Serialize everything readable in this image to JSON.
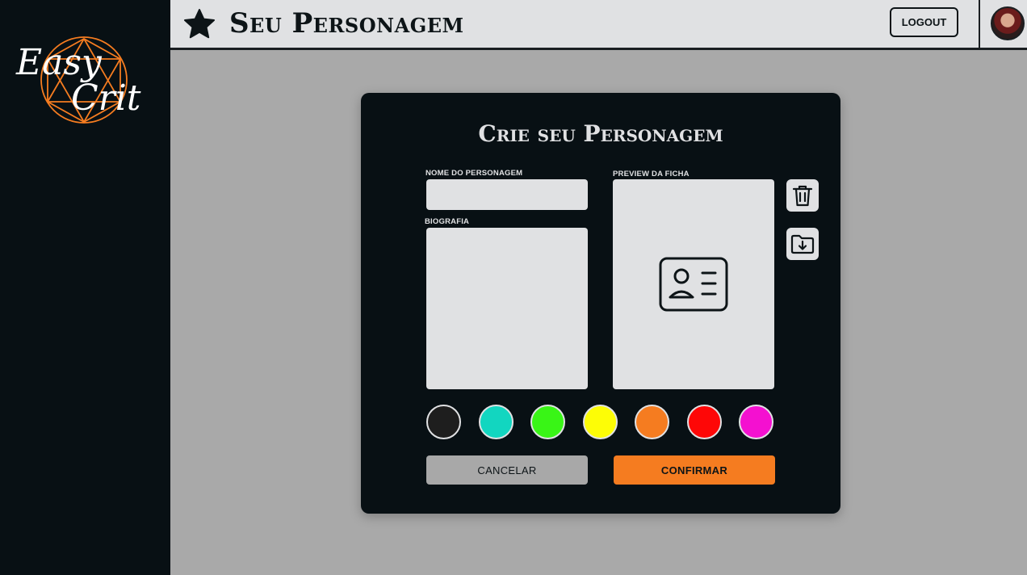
{
  "brand": {
    "line1": "Easy",
    "line2": "Crit"
  },
  "header": {
    "title": "Seu Personagem",
    "logout_label": "LOGOUT"
  },
  "modal": {
    "title": "Crie seu Personagem",
    "name_label": "NOME DO PERSONAGEM",
    "name_value": "",
    "bio_label": "BIOGRAFIA",
    "bio_value": "",
    "preview_label": "PREVIEW DA FICHA",
    "colors": [
      "#1e1e1e",
      "#12d6c0",
      "#39f516",
      "#fdfd06",
      "#f57c20",
      "#fe0707",
      "#f410d0"
    ],
    "cancel_label": "CANCELAR",
    "confirm_label": "CONFIRMAR"
  },
  "icons": {
    "header": "star-icon",
    "preview": "id-card-icon",
    "delete": "trash-icon",
    "import": "folder-download-icon"
  },
  "theme": {
    "dark": "#081014",
    "light": "#e0e1e3",
    "accent": "#f57c20",
    "backdrop": "#a9a9a9"
  }
}
